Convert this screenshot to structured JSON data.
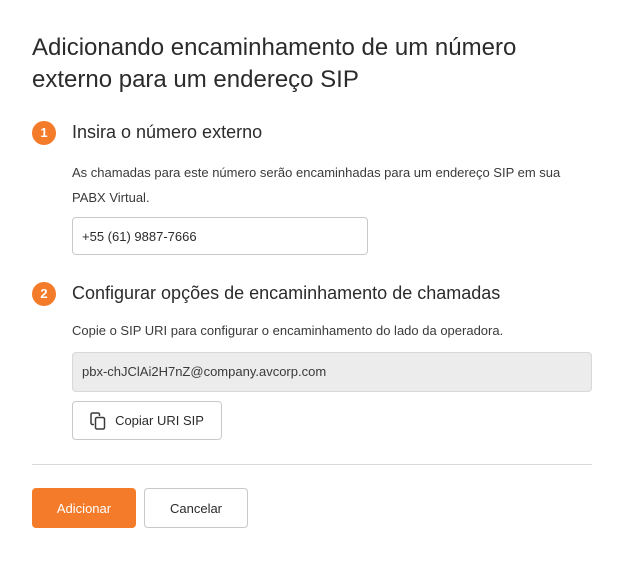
{
  "dialog": {
    "title": "Adicionando encaminhamento de um número externo para um endereço SIP"
  },
  "step1": {
    "number": "1",
    "title": "Insira o número externo",
    "description": "As chamadas para este número serão encaminhadas para um endereço SIP em sua PABX Virtual.",
    "phone_value": "+55 (61) 9887-7666"
  },
  "step2": {
    "number": "2",
    "title": "Configurar opções de encaminhamento de chamadas",
    "description": "Copie o SIP URI para configurar o encaminhamento do lado da operadora.",
    "sip_uri": "pbx-chJClAi2H7nZ@company.avcorp.com",
    "copy_button_label": "Copiar URI SIP",
    "copy_icon": "copy-icon"
  },
  "footer": {
    "add_label": "Adicionar",
    "cancel_label": "Cancelar"
  },
  "colors": {
    "accent": "#f47b2a",
    "readonly_bg": "#ececec",
    "divider": "#d9d9d9"
  }
}
